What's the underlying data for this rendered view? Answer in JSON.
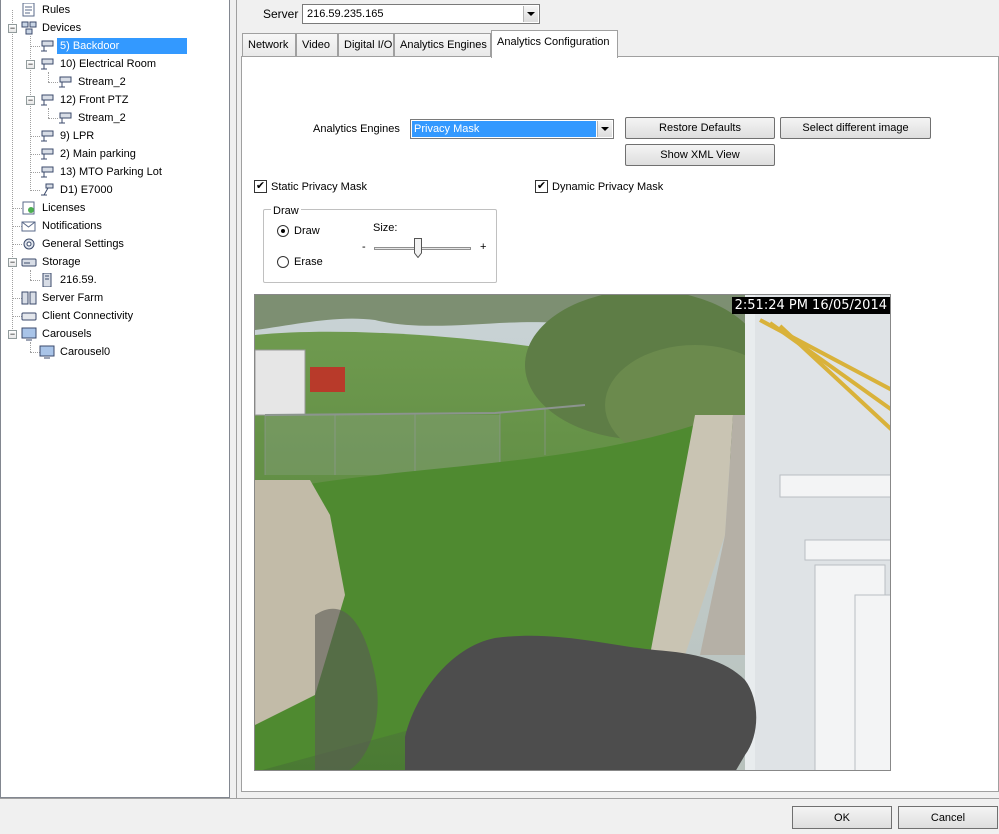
{
  "tree": {
    "items": [
      {
        "label": "Rules",
        "icon": "rules-icon"
      },
      {
        "label": "Devices",
        "icon": "devices-icon"
      },
      {
        "label": "5) Backdoor",
        "icon": "camera-icon",
        "selected": true
      },
      {
        "label": "10) Electrical Room",
        "icon": "camera-icon"
      },
      {
        "label": "Stream_2",
        "icon": "camera-icon"
      },
      {
        "label": "12) Front PTZ",
        "icon": "camera-icon"
      },
      {
        "label": "Stream_2",
        "icon": "camera-icon"
      },
      {
        "label": "9) LPR",
        "icon": "camera-icon"
      },
      {
        "label": "2) Main parking",
        "icon": "camera-icon"
      },
      {
        "label": "13) MTO Parking Lot",
        "icon": "camera-icon"
      },
      {
        "label": "D1) E7000",
        "icon": "encoder-icon"
      },
      {
        "label": "Licenses",
        "icon": "license-icon"
      },
      {
        "label": "Notifications",
        "icon": "notification-icon"
      },
      {
        "label": "General Settings",
        "icon": "gear-icon"
      },
      {
        "label": "Storage",
        "icon": "storage-icon"
      },
      {
        "label": "216.59.",
        "icon": "server-icon"
      },
      {
        "label": "Server Farm",
        "icon": "server-farm-icon"
      },
      {
        "label": "Client Connectivity",
        "icon": "client-icon"
      },
      {
        "label": "Carousels",
        "icon": "carousel-icon"
      },
      {
        "label": "Carousel0",
        "icon": "monitor-icon"
      }
    ]
  },
  "server": {
    "label": "Server",
    "value": "216.59.235.165"
  },
  "tabs": [
    {
      "label": "Network"
    },
    {
      "label": "Video"
    },
    {
      "label": "Digital I/O"
    },
    {
      "label": "Analytics Engines"
    },
    {
      "label": "Analytics Configuration",
      "active": true
    }
  ],
  "analytics": {
    "engines_label": "Analytics Engines",
    "engine_value": "Privacy Mask",
    "restore_defaults": "Restore Defaults",
    "select_image": "Select different image",
    "show_xml": "Show XML View"
  },
  "masks": {
    "static_label": "Static Privacy Mask",
    "static_checked": true,
    "dynamic_label": "Dynamic Privacy Mask",
    "dynamic_checked": true
  },
  "draw": {
    "group_label": "Draw",
    "draw_option": "Draw",
    "erase_option": "Erase",
    "selected": "Draw",
    "size_label": "Size:",
    "minus": "-",
    "plus": "+",
    "size_fraction": 0.45
  },
  "camera": {
    "timestamp": "2:51:24 PM 16/05/2014"
  },
  "footer": {
    "ok": "OK",
    "cancel": "Cancel"
  },
  "colors": {
    "selection": "#3399ff",
    "mask": "#4d4d4d"
  }
}
